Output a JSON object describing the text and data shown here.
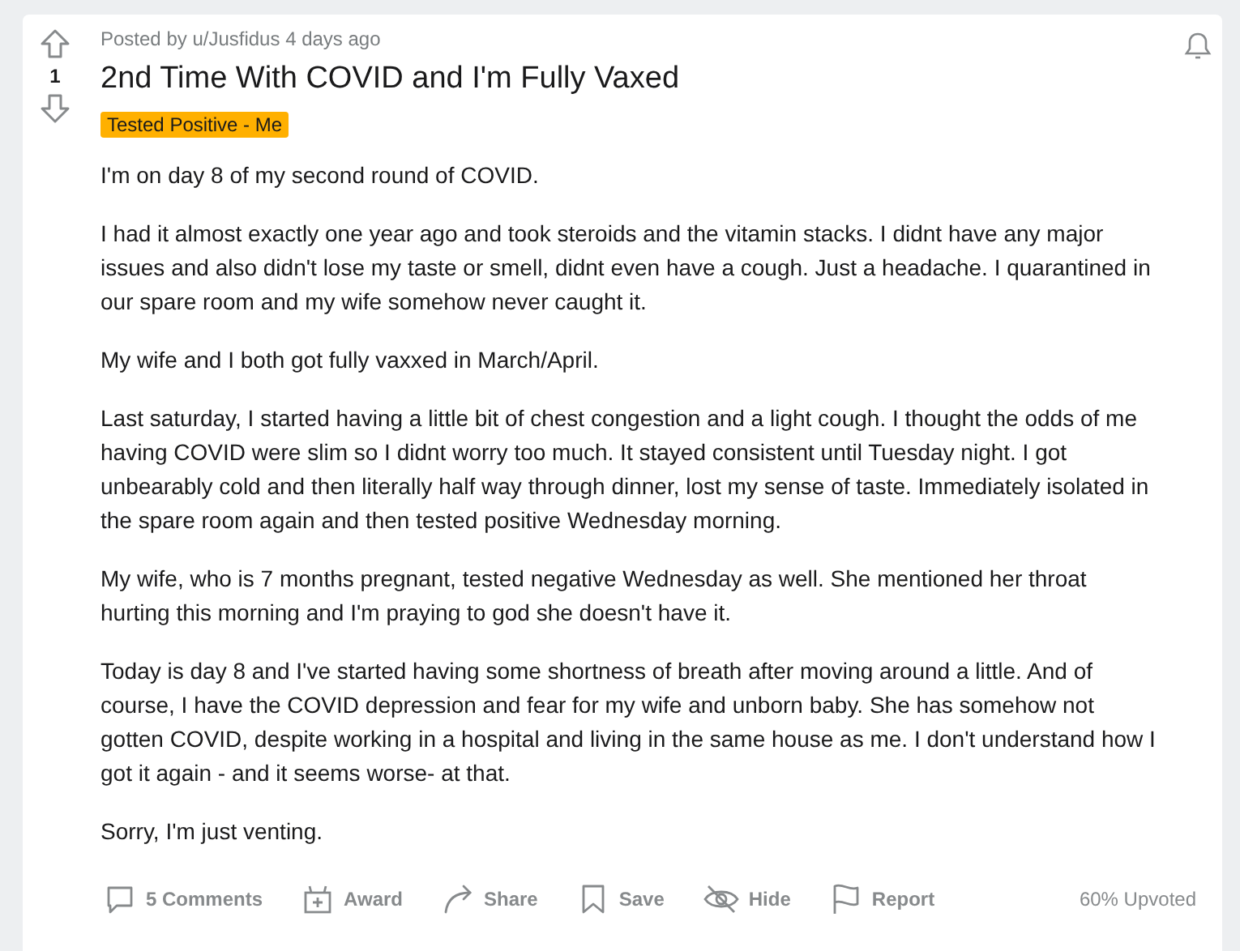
{
  "post": {
    "score": "1",
    "byline": "Posted by u/Jusfidus 4 days ago",
    "title": "2nd Time With COVID and I'm Fully Vaxed",
    "flair": {
      "label": "Tested Positive - Me",
      "color": "#ffb000"
    },
    "paragraphs": [
      "I'm on day 8 of my second round of COVID.",
      "I had it almost exactly one year ago and took steroids and the vitamin stacks. I didnt have any major issues and also didn't lose my taste or smell, didnt even have a cough. Just a headache. I quarantined in our spare room and my wife somehow never caught it.",
      "My wife and I both got fully vaxxed in March/April.",
      "Last saturday, I started having a little bit of chest congestion and a light cough. I thought the odds of me having COVID were slim so I didnt worry too much. It stayed consistent until Tuesday night. I got unbearably cold and then literally half way through dinner, lost my sense of taste. Immediately isolated in the spare room again and then tested positive Wednesday morning.",
      "My wife, who is 7 months pregnant, tested negative Wednesday as well. She mentioned her throat hurting this morning and I'm praying to god she doesn't have it.",
      "Today is day 8 and I've started having some shortness of breath after moving around a little. And of course, I have the COVID depression and fear for my wife and unborn baby. She has somehow not gotten COVID, despite working in a hospital and living in the same house as me. I don't understand how I got it again - and it seems worse- at that.",
      "Sorry, I'm just venting."
    ],
    "actions": [
      {
        "kind": "comment",
        "label": "5 Comments"
      },
      {
        "kind": "award",
        "label": "Award"
      },
      {
        "kind": "share",
        "label": "Share"
      },
      {
        "kind": "save",
        "label": "Save"
      },
      {
        "kind": "hide",
        "label": "Hide"
      },
      {
        "kind": "report",
        "label": "Report"
      }
    ],
    "upvote_ratio": "60% Upvoted"
  }
}
